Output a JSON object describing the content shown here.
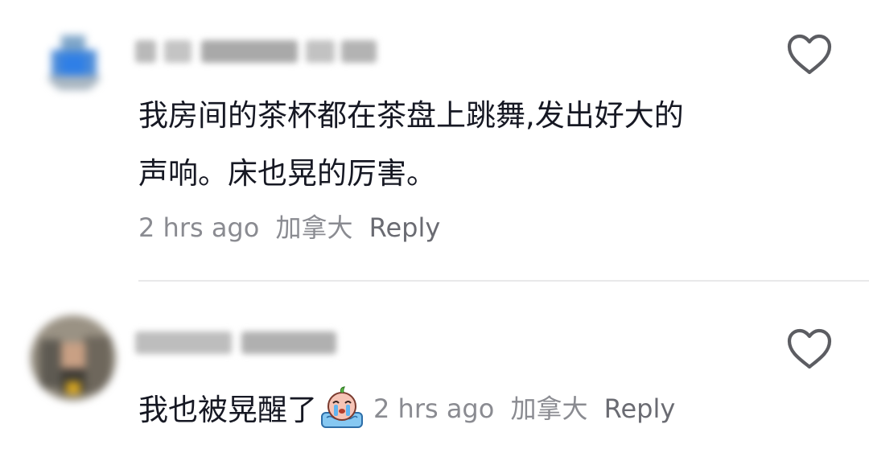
{
  "comments": [
    {
      "text_lines": [
        "我房间的茶杯都在茶盘上跳舞,发出好大的",
        "声响。床也晃的厉害。"
      ],
      "time": "2 hrs ago",
      "location": "加拿大",
      "reply_label": "Reply",
      "like_icon": "heart-outline-icon"
    },
    {
      "text": "我也被晃醒了",
      "emoji": "crying-face-emoji",
      "time": "2 hrs ago",
      "location": "加拿大",
      "reply_label": "Reply",
      "like_icon": "heart-outline-icon"
    }
  ],
  "colors": {
    "text": "#161823",
    "meta": "#8a8b91",
    "reply": "#6a6b72",
    "divider": "#e9e9ea"
  }
}
